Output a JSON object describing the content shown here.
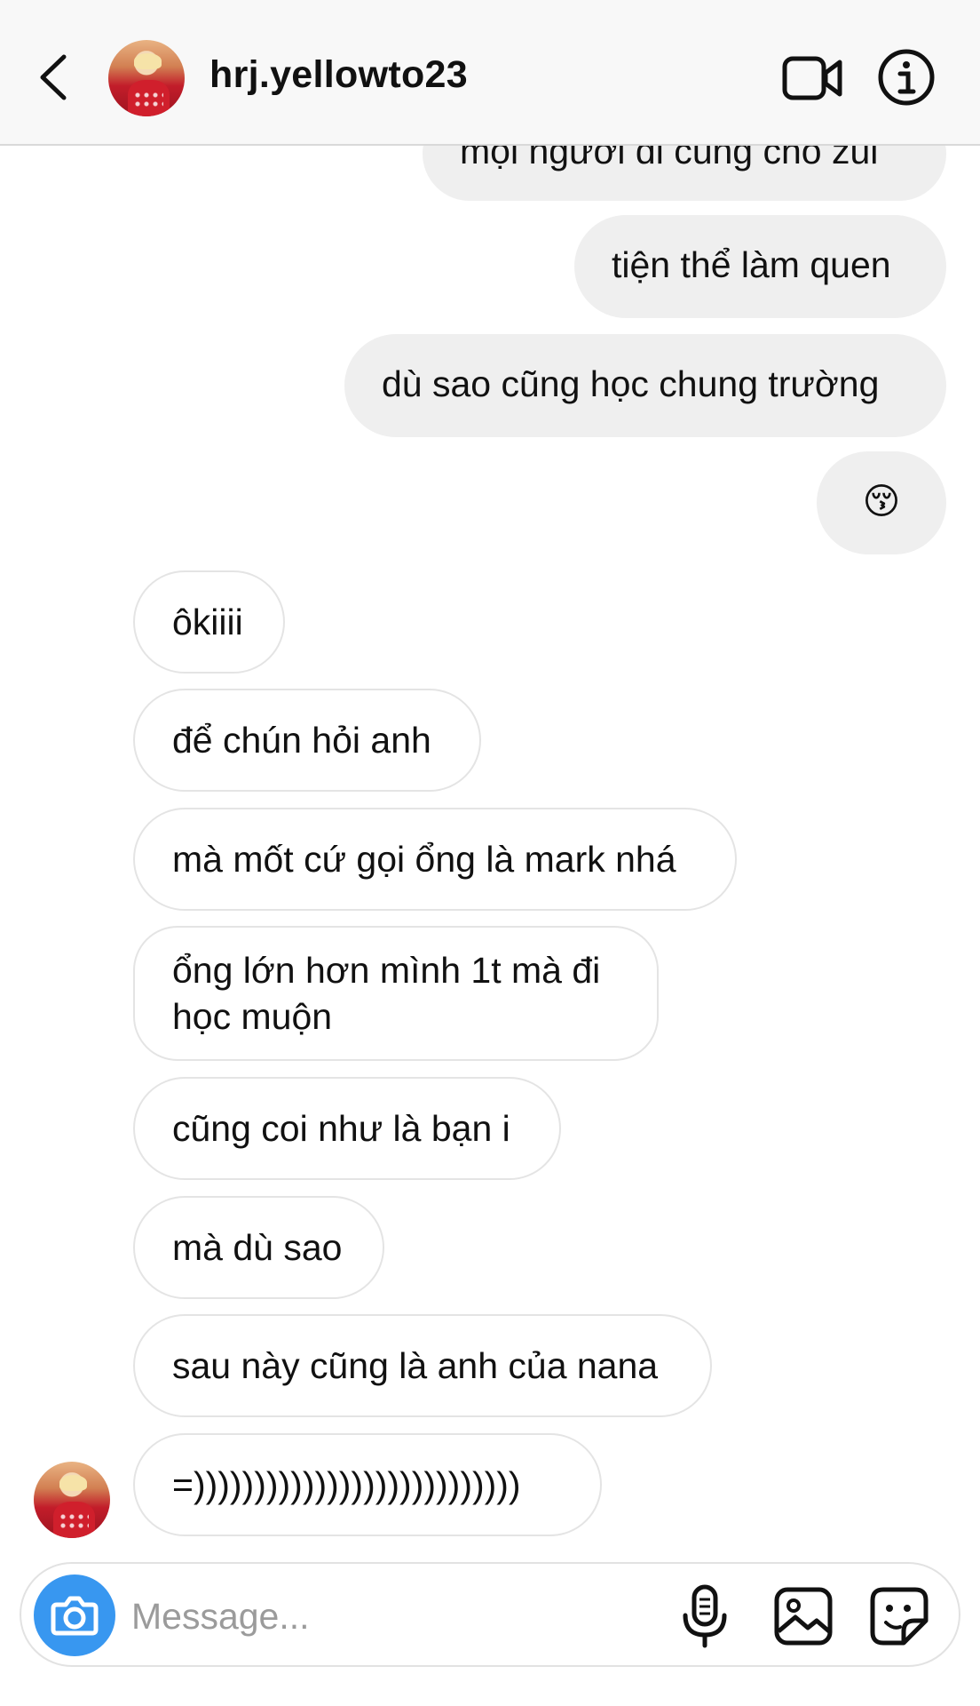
{
  "header": {
    "username": "hrj.yellowto23",
    "icons": {
      "back": "chevron-left-icon",
      "video": "video-call-icon",
      "info": "info-icon"
    }
  },
  "messages": {
    "outgoing": [
      "mọi người đi cùng cho zui",
      "tiện thể làm quen",
      "dù sao cũng học chung trường",
      "😚"
    ],
    "incoming": [
      "ôkiiii",
      "để chún hỏi anh",
      "mà mốt cứ gọi ổng là mark nhá",
      "ổng lớn hơn mình 1t mà đi học muộn",
      "cũng coi như là bạn i",
      "mà dù sao",
      "sau này cũng là anh của nana",
      "=)))))))))))))))))))))))))))"
    ]
  },
  "composer": {
    "placeholder": "Message...",
    "icons": {
      "camera": "camera-icon",
      "mic": "microphone-icon",
      "gallery": "gallery-icon",
      "sticker": "sticker-icon"
    }
  },
  "colors": {
    "accent": "#3897f0",
    "outgoing_bubble": "#efefef",
    "incoming_border": "#e4e4e4",
    "header_bg": "#f8f8f8"
  }
}
